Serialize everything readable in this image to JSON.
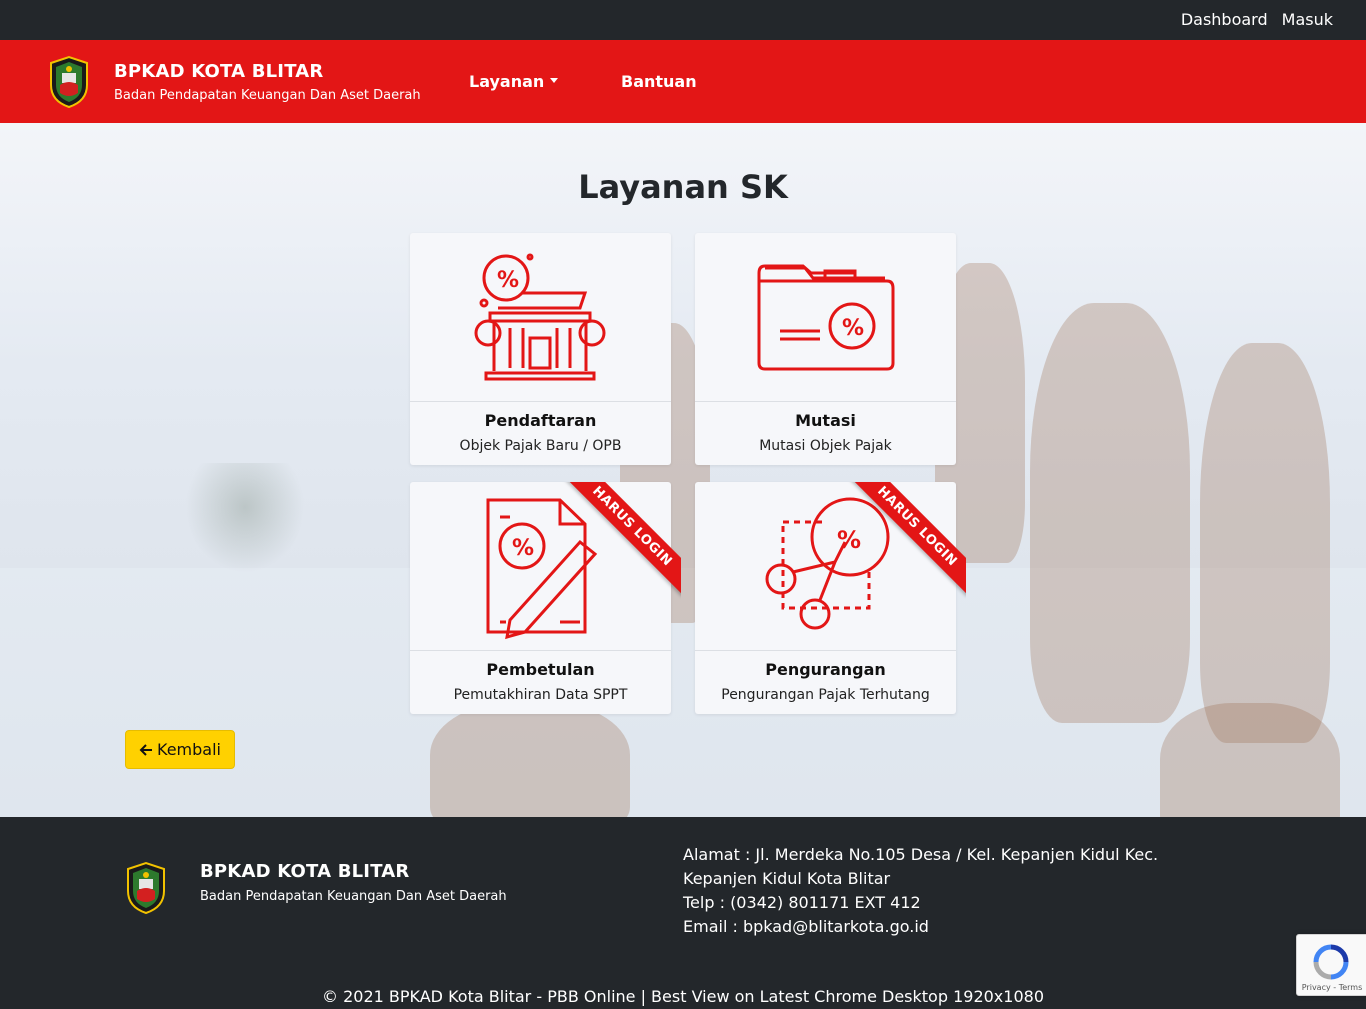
{
  "topbar": {
    "links": [
      "Dashboard",
      "Masuk"
    ]
  },
  "brand": {
    "title": "BPKAD KOTA BLITAR",
    "subtitle": "Badan Pendapatan Keuangan Dan Aset Daerah",
    "logo_icon": "city-crest-icon"
  },
  "nav": {
    "layanan": "Layanan",
    "bantuan": "Bantuan"
  },
  "page": {
    "title": "Layanan SK"
  },
  "cards": [
    {
      "title": "Pendaftaran",
      "subtitle": "Objek Pajak Baru / OPB",
      "icon": "tax-building-icon",
      "ribbon": ""
    },
    {
      "title": "Mutasi",
      "subtitle": "Mutasi Objek Pajak",
      "icon": "tax-folder-icon",
      "ribbon": ""
    },
    {
      "title": "Pembetulan",
      "subtitle": "Pemutakhiran Data SPPT",
      "icon": "tax-document-edit-icon",
      "ribbon": "HARUS LOGIN"
    },
    {
      "title": "Pengurangan",
      "subtitle": "Pengurangan Pajak Terhutang",
      "icon": "tax-cut-icon",
      "ribbon": "HARUS LOGIN"
    }
  ],
  "back_button": {
    "label": "Kembali",
    "icon": "arrow-left-icon"
  },
  "footer": {
    "address": "Alamat : Jl. Merdeka No.105 Desa / Kel. Kepanjen Kidul Kec. Kepanjen Kidul Kota Blitar",
    "phone": "Telp : (0342) 801171 EXT 412",
    "email": "Email : bpkad@blitarkota.go.id",
    "copyright": "© 2021 BPKAD Kota Blitar - PBB Online | Best View on Latest Chrome Desktop 1920x1080"
  },
  "recaptcha": {
    "text": "Privacy - Terms"
  },
  "colors": {
    "primary_red": "#e31616",
    "dark": "#23272b",
    "button_yellow": "#ffd100"
  }
}
